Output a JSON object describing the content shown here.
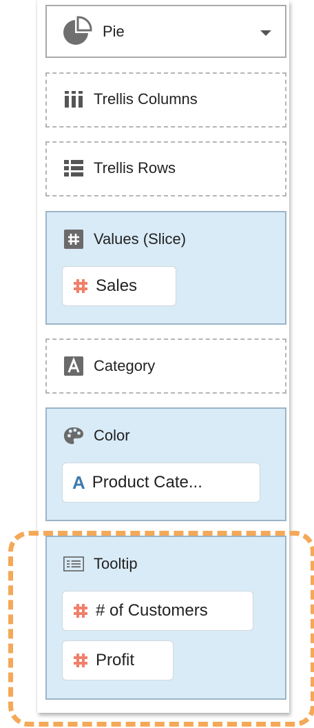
{
  "chart_type": {
    "label": "Pie",
    "icon": "pie-chart-icon"
  },
  "zones": {
    "trellis_columns": {
      "label": "Trellis Columns",
      "icon": "columns-icon"
    },
    "trellis_rows": {
      "label": "Trellis Rows",
      "icon": "rows-list-icon"
    },
    "values": {
      "label": "Values (Slice)",
      "icon": "hash-box-icon",
      "items": [
        {
          "label": "Sales",
          "icon": "hash-icon"
        }
      ]
    },
    "category": {
      "label": "Category",
      "icon": "letter-a-box-icon"
    },
    "color": {
      "label": "Color",
      "icon": "palette-icon",
      "items": [
        {
          "label": "Product Cate...",
          "icon": "letter-a-icon"
        }
      ]
    },
    "tooltip": {
      "label": "Tooltip",
      "icon": "tooltip-list-icon",
      "items": [
        {
          "label": "# of Customers",
          "icon": "hash-icon"
        },
        {
          "label": "Profit",
          "icon": "hash-icon"
        }
      ]
    }
  },
  "colors": {
    "zone_fill": "#d9ebf7",
    "measure_icon": "#f0806a",
    "attribute_icon": "#3d7aad",
    "highlight": "#f5a857"
  }
}
